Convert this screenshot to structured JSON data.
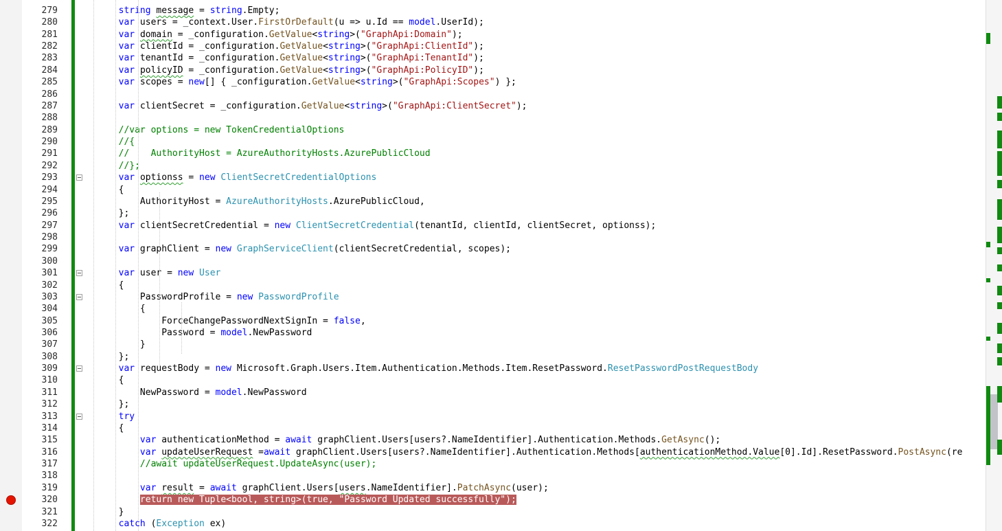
{
  "editor": {
    "lines": [
      {
        "n": "279",
        "tokens": [
          [
            "pl",
            "        "
          ],
          [
            "kw",
            "string"
          ],
          [
            "pl",
            " "
          ],
          [
            "sq",
            "message"
          ],
          [
            "pl",
            " = "
          ],
          [
            "kw",
            "string"
          ],
          [
            "pl",
            ".Empty;"
          ]
        ]
      },
      {
        "n": "280",
        "tokens": [
          [
            "pl",
            "        "
          ],
          [
            "kw",
            "var"
          ],
          [
            "pl",
            " users = _context.User."
          ],
          [
            "me",
            "FirstOrDefault"
          ],
          [
            "pl",
            "(u => u.Id == "
          ],
          [
            "kw",
            "model"
          ],
          [
            "pl",
            ".UserId);"
          ]
        ]
      },
      {
        "n": "281",
        "tokens": [
          [
            "pl",
            "        "
          ],
          [
            "kw",
            "var"
          ],
          [
            "pl",
            " "
          ],
          [
            "sq",
            "domain"
          ],
          [
            "pl",
            " = _configuration."
          ],
          [
            "me",
            "GetValue"
          ],
          [
            "pl",
            "<"
          ],
          [
            "kw",
            "string"
          ],
          [
            "pl",
            ">("
          ],
          [
            "st",
            "\"GraphApi:Domain\""
          ],
          [
            "pl",
            ");"
          ]
        ]
      },
      {
        "n": "282",
        "tokens": [
          [
            "pl",
            "        "
          ],
          [
            "kw",
            "var"
          ],
          [
            "pl",
            " clientId = _configuration."
          ],
          [
            "me",
            "GetValue"
          ],
          [
            "pl",
            "<"
          ],
          [
            "kw",
            "string"
          ],
          [
            "pl",
            ">("
          ],
          [
            "st",
            "\"GraphApi:ClientId\""
          ],
          [
            "pl",
            ");"
          ]
        ]
      },
      {
        "n": "283",
        "tokens": [
          [
            "pl",
            "        "
          ],
          [
            "kw",
            "var"
          ],
          [
            "pl",
            " tenantId = _configuration."
          ],
          [
            "me",
            "GetValue"
          ],
          [
            "pl",
            "<"
          ],
          [
            "kw",
            "string"
          ],
          [
            "pl",
            ">("
          ],
          [
            "st",
            "\"GraphApi:TenantId\""
          ],
          [
            "pl",
            ");"
          ]
        ]
      },
      {
        "n": "284",
        "tokens": [
          [
            "pl",
            "        "
          ],
          [
            "kw",
            "var"
          ],
          [
            "pl",
            " "
          ],
          [
            "sq",
            "policyID"
          ],
          [
            "pl",
            " = _configuration."
          ],
          [
            "me",
            "GetValue"
          ],
          [
            "pl",
            "<"
          ],
          [
            "kw",
            "string"
          ],
          [
            "pl",
            ">("
          ],
          [
            "st",
            "\"GraphApi:PolicyID\""
          ],
          [
            "pl",
            ");"
          ]
        ]
      },
      {
        "n": "285",
        "tokens": [
          [
            "pl",
            "        "
          ],
          [
            "kw",
            "var"
          ],
          [
            "pl",
            " scopes = "
          ],
          [
            "kw",
            "new"
          ],
          [
            "pl",
            "[] { _configuration."
          ],
          [
            "me",
            "GetValue"
          ],
          [
            "pl",
            "<"
          ],
          [
            "kw",
            "string"
          ],
          [
            "pl",
            ">("
          ],
          [
            "st",
            "\"GraphApi:Scopes\""
          ],
          [
            "pl",
            ") };"
          ]
        ]
      },
      {
        "n": "286",
        "tokens": []
      },
      {
        "n": "287",
        "tokens": [
          [
            "pl",
            "        "
          ],
          [
            "kw",
            "var"
          ],
          [
            "pl",
            " clientSecret = _configuration."
          ],
          [
            "me",
            "GetValue"
          ],
          [
            "pl",
            "<"
          ],
          [
            "kw",
            "string"
          ],
          [
            "pl",
            ">("
          ],
          [
            "st",
            "\"GraphApi:ClientSecret\""
          ],
          [
            "pl",
            ");"
          ]
        ]
      },
      {
        "n": "288",
        "tokens": []
      },
      {
        "n": "289",
        "tokens": [
          [
            "pl",
            "        "
          ],
          [
            "cm",
            "//var options = new TokenCredentialOptions"
          ]
        ]
      },
      {
        "n": "290",
        "tokens": [
          [
            "pl",
            "        "
          ],
          [
            "cm",
            "//{"
          ]
        ]
      },
      {
        "n": "291",
        "tokens": [
          [
            "pl",
            "        "
          ],
          [
            "cm",
            "//    AuthorityHost = AzureAuthorityHosts.AzurePublicCloud"
          ]
        ]
      },
      {
        "n": "292",
        "tokens": [
          [
            "pl",
            "        "
          ],
          [
            "cm",
            "//};"
          ]
        ]
      },
      {
        "n": "293",
        "tokens": [
          [
            "pl",
            "        "
          ],
          [
            "kw",
            "var"
          ],
          [
            "pl",
            " "
          ],
          [
            "sq",
            "optionss"
          ],
          [
            "pl",
            " = "
          ],
          [
            "kw",
            "new"
          ],
          [
            "pl",
            " "
          ],
          [
            "ty",
            "ClientSecretCredentialOptions"
          ]
        ]
      },
      {
        "n": "294",
        "tokens": [
          [
            "pl",
            "        {"
          ]
        ]
      },
      {
        "n": "295",
        "tokens": [
          [
            "pl",
            "            AuthorityHost = "
          ],
          [
            "ty",
            "AzureAuthorityHosts"
          ],
          [
            "pl",
            ".AzurePublicCloud,"
          ]
        ]
      },
      {
        "n": "296",
        "tokens": [
          [
            "pl",
            "        };"
          ]
        ]
      },
      {
        "n": "297",
        "tokens": [
          [
            "pl",
            "        "
          ],
          [
            "kw",
            "var"
          ],
          [
            "pl",
            " clientSecretCredential = "
          ],
          [
            "kw",
            "new"
          ],
          [
            "pl",
            " "
          ],
          [
            "ty",
            "ClientSecretCredential"
          ],
          [
            "pl",
            "(tenantId, clientId, clientSecret, optionss);"
          ]
        ]
      },
      {
        "n": "298",
        "tokens": []
      },
      {
        "n": "299",
        "tokens": [
          [
            "pl",
            "        "
          ],
          [
            "kw",
            "var"
          ],
          [
            "pl",
            " graphClient = "
          ],
          [
            "kw",
            "new"
          ],
          [
            "pl",
            " "
          ],
          [
            "ty",
            "GraphServiceClient"
          ],
          [
            "pl",
            "(clientSecretCredential, scopes);"
          ]
        ]
      },
      {
        "n": "300",
        "tokens": []
      },
      {
        "n": "301",
        "tokens": [
          [
            "pl",
            "        "
          ],
          [
            "kw",
            "var"
          ],
          [
            "pl",
            " user = "
          ],
          [
            "kw",
            "new"
          ],
          [
            "pl",
            " "
          ],
          [
            "ty",
            "User"
          ]
        ]
      },
      {
        "n": "302",
        "tokens": [
          [
            "pl",
            "        {"
          ]
        ]
      },
      {
        "n": "303",
        "tokens": [
          [
            "pl",
            "            PasswordProfile = "
          ],
          [
            "kw",
            "new"
          ],
          [
            "pl",
            " "
          ],
          [
            "ty",
            "PasswordProfile"
          ]
        ]
      },
      {
        "n": "304",
        "tokens": [
          [
            "pl",
            "            {"
          ]
        ]
      },
      {
        "n": "305",
        "tokens": [
          [
            "pl",
            "                ForceChangePasswordNextSignIn = "
          ],
          [
            "kw",
            "false"
          ],
          [
            "pl",
            ","
          ]
        ]
      },
      {
        "n": "306",
        "tokens": [
          [
            "pl",
            "                Password = "
          ],
          [
            "kw",
            "model"
          ],
          [
            "pl",
            ".NewPassword"
          ]
        ]
      },
      {
        "n": "307",
        "tokens": [
          [
            "pl",
            "            }"
          ]
        ]
      },
      {
        "n": "308",
        "tokens": [
          [
            "pl",
            "        };"
          ]
        ]
      },
      {
        "n": "309",
        "tokens": [
          [
            "pl",
            "        "
          ],
          [
            "kw",
            "var"
          ],
          [
            "pl",
            " requestBody = "
          ],
          [
            "kw",
            "new"
          ],
          [
            "pl",
            " Microsoft.Graph.Users.Item.Authentication.Methods.Item.ResetPassword."
          ],
          [
            "ty",
            "ResetPasswordPostRequestBody"
          ]
        ]
      },
      {
        "n": "310",
        "tokens": [
          [
            "pl",
            "        {"
          ]
        ]
      },
      {
        "n": "311",
        "tokens": [
          [
            "pl",
            "            NewPassword = "
          ],
          [
            "kw",
            "model"
          ],
          [
            "pl",
            ".NewPassword"
          ]
        ]
      },
      {
        "n": "312",
        "tokens": [
          [
            "pl",
            "        };"
          ]
        ]
      },
      {
        "n": "313",
        "tokens": [
          [
            "pl",
            "        "
          ],
          [
            "kw",
            "try"
          ]
        ]
      },
      {
        "n": "314",
        "tokens": [
          [
            "pl",
            "        {"
          ]
        ]
      },
      {
        "n": "315",
        "tokens": [
          [
            "pl",
            "            "
          ],
          [
            "kw",
            "var"
          ],
          [
            "pl",
            " authenticationMethod = "
          ],
          [
            "kw",
            "await"
          ],
          [
            "pl",
            " graphClient.Users[users?.NameIdentifier].Authentication.Methods."
          ],
          [
            "me",
            "GetAsync"
          ],
          [
            "pl",
            "();"
          ]
        ]
      },
      {
        "n": "316",
        "tokens": [
          [
            "pl",
            "            "
          ],
          [
            "kw",
            "var"
          ],
          [
            "pl",
            " "
          ],
          [
            "sq",
            "updateUserRequest"
          ],
          [
            "pl",
            " ="
          ],
          [
            "kw",
            "await"
          ],
          [
            "pl",
            " graphClient.Users[users?.NameIdentifier].Authentication.Methods["
          ],
          [
            "sq",
            "authenticationMethod.Value"
          ],
          [
            "pl",
            "[0].Id].ResetPassword."
          ],
          [
            "me",
            "PostAsync"
          ],
          [
            "pl",
            "(re"
          ]
        ]
      },
      {
        "n": "317",
        "tokens": [
          [
            "pl",
            "            "
          ],
          [
            "cm",
            "//await updateUserRequest.UpdateAsync(user);"
          ]
        ]
      },
      {
        "n": "318",
        "tokens": []
      },
      {
        "n": "319",
        "tokens": [
          [
            "pl",
            "            "
          ],
          [
            "kw",
            "var"
          ],
          [
            "pl",
            " "
          ],
          [
            "sq",
            "result"
          ],
          [
            "pl",
            " = "
          ],
          [
            "kw",
            "await"
          ],
          [
            "pl",
            " graphClient.Users["
          ],
          [
            "sq",
            "users"
          ],
          [
            "pl",
            ".NameIdentifier]."
          ],
          [
            "me",
            "PatchAsync"
          ],
          [
            "pl",
            "(user);"
          ]
        ]
      },
      {
        "n": "320",
        "bp": true,
        "tokens": [
          [
            "pl",
            "            "
          ],
          [
            "bp",
            "return new Tuple<bool, string>(true, \"Password Updated successfully\");"
          ]
        ]
      },
      {
        "n": "321",
        "tokens": [
          [
            "pl",
            "        }"
          ]
        ]
      },
      {
        "n": "322",
        "tokens": [
          [
            "pl",
            "        "
          ],
          [
            "kw",
            "catch"
          ],
          [
            "pl",
            " ("
          ],
          [
            "ty",
            "Exception"
          ],
          [
            "pl",
            " ex)"
          ]
        ]
      }
    ]
  },
  "colors": {
    "keyword": "#0000ff",
    "type": "#2b91af",
    "string": "#a31515",
    "comment": "#008000",
    "breakpoint_line": "#b95a5a",
    "change_bar": "#108a10"
  }
}
